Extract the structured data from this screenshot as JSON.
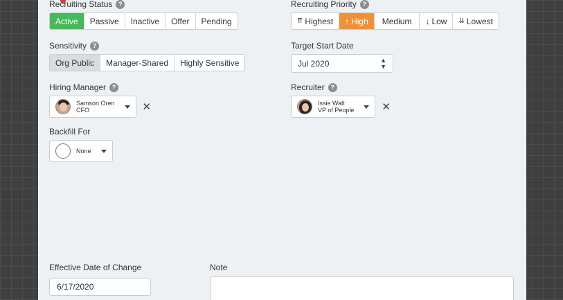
{
  "recruiting_status": {
    "label": "Recruiting Status",
    "options": [
      "Active",
      "Passive",
      "Inactive",
      "Offer",
      "Pending"
    ],
    "selected": "Active"
  },
  "recruiting_priority": {
    "label": "Recruiting Priority",
    "options": [
      {
        "icon": "⇈",
        "label": "Highest"
      },
      {
        "icon": "↑",
        "label": "High"
      },
      {
        "icon": "",
        "label": "Medium"
      },
      {
        "icon": "↓",
        "label": "Low"
      },
      {
        "icon": "⇊",
        "label": "Lowest"
      }
    ],
    "selected": "High"
  },
  "sensitivity": {
    "label": "Sensitivity",
    "options": [
      "Org Public",
      "Manager-Shared",
      "Highly Sensitive"
    ],
    "selected": "Org Public"
  },
  "target_start_date": {
    "label": "Target Start Date",
    "value": "Jul 2020"
  },
  "hiring_manager": {
    "label": "Hiring Manager",
    "name": "Samson Oren",
    "title": "CFO"
  },
  "recruiter": {
    "label": "Recruiter",
    "name": "Issie Walt",
    "title": "VP of People"
  },
  "backfill_for": {
    "label": "Backfill For",
    "value": "None"
  },
  "effective_date": {
    "label": "Effective Date of Change",
    "value": "6/17/2020"
  },
  "note": {
    "label": "Note",
    "value": ""
  },
  "colors": {
    "active_green": "#46b95a",
    "priority_orange": "#f0913a",
    "panel_bg": "#eef1f3"
  }
}
